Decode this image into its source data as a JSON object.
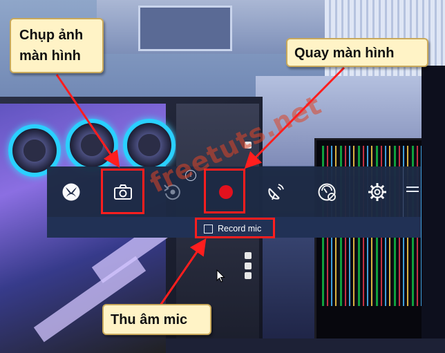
{
  "callouts": {
    "screenshot_line1": "Chụp ảnh",
    "screenshot_line2": "màn hình",
    "record": "Quay màn hình",
    "mic": "Thu âm mic"
  },
  "gamebar": {
    "buttons": [
      {
        "name": "xbox",
        "icon": "xbox-logo-icon"
      },
      {
        "name": "screenshot",
        "icon": "camera-icon"
      },
      {
        "name": "record-last",
        "icon": "rewind-record-icon"
      },
      {
        "name": "record",
        "icon": "record-dot-icon"
      },
      {
        "name": "broadcast",
        "icon": "broadcast-icon"
      },
      {
        "name": "performance",
        "icon": "gauge-icon"
      },
      {
        "name": "settings",
        "icon": "gear-icon"
      }
    ],
    "info_glyph": "i",
    "record_mic_label": "Record mic",
    "record_mic_checked": false
  },
  "watermark": "freetuts.net",
  "colors": {
    "highlight": "#ff1e1e",
    "callout_bg": "#fff3c6",
    "bar_bg": "#1d2a44",
    "record_dot": "#e8101d"
  }
}
